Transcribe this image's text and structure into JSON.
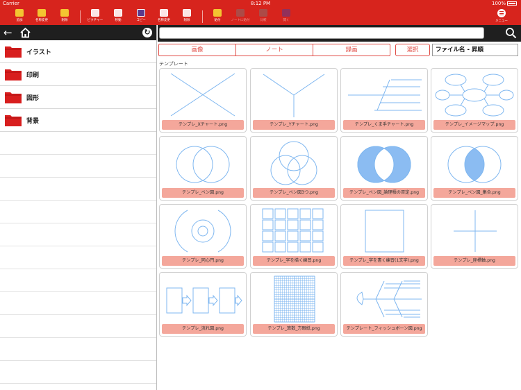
{
  "status": {
    "carrier": "Carrier",
    "time": "8:12 PM",
    "battery": "100%"
  },
  "toolbar": {
    "items": [
      {
        "label": "追加"
      },
      {
        "label": "名称変更"
      },
      {
        "label": "削除"
      },
      {
        "label": "ピクチャー"
      },
      {
        "label": "移動"
      },
      {
        "label": "コピー"
      },
      {
        "label": "名称変更"
      },
      {
        "label": "削除"
      },
      {
        "label": "貼付"
      },
      {
        "label": "ノートに貼付"
      },
      {
        "label": "比較"
      },
      {
        "label": "開く"
      }
    ],
    "menu_label": "メニュー"
  },
  "sidebar": {
    "back_glyph": "←",
    "refresh_glyph": "↻",
    "folders": [
      {
        "name": "イラスト"
      },
      {
        "name": "印刷"
      },
      {
        "name": "図形"
      },
      {
        "name": "背景"
      }
    ]
  },
  "search": {
    "value": "",
    "placeholder": ""
  },
  "tabs": [
    {
      "label": "画像"
    },
    {
      "label": "ノート"
    },
    {
      "label": "録画"
    }
  ],
  "select_label": "選択",
  "sort_label": "ファイル名 - 昇順",
  "section_label": "テンプレート",
  "files": [
    {
      "name": "テンプレ_Xチャート.png",
      "icon": "x-chart"
    },
    {
      "name": "テンプレ_Yチャート.png",
      "icon": "y-chart"
    },
    {
      "name": "テンプレ_くま手チャート.png",
      "icon": "rake-chart"
    },
    {
      "name": "テンプレ_イメージマップ.png",
      "icon": "image-map"
    },
    {
      "name": "テンプレ_ベン図.png",
      "icon": "venn-2"
    },
    {
      "name": "テンプレ_ベン図3つ.png",
      "icon": "venn-3"
    },
    {
      "name": "テンプレ_ベン図_論理積の否定.png",
      "icon": "venn-nand"
    },
    {
      "name": "テンプレ_ベン図_集合.png",
      "icon": "venn-intersection"
    },
    {
      "name": "テンプレ_同心円.png",
      "icon": "concentric"
    },
    {
      "name": "テンプレ_字を描く練習.png",
      "icon": "writing-grid"
    },
    {
      "name": "テンプレ_字を書く練習(1文字).png",
      "icon": "single-box"
    },
    {
      "name": "テンプレ_座標軸.png",
      "icon": "axes"
    },
    {
      "name": "テンプレ_流れ図.png",
      "icon": "flow"
    },
    {
      "name": "テンプレ_算数_方眼紙.png",
      "icon": "graph-paper"
    },
    {
      "name": "テンプレート_フィッシュボーン図.png",
      "icon": "fishbone"
    }
  ],
  "colors": {
    "toolbar": "#d7241d",
    "caption": "#f4a79b",
    "accent": "#e04b44",
    "folder": "#d81e1e",
    "line": "#7fb7f0"
  }
}
